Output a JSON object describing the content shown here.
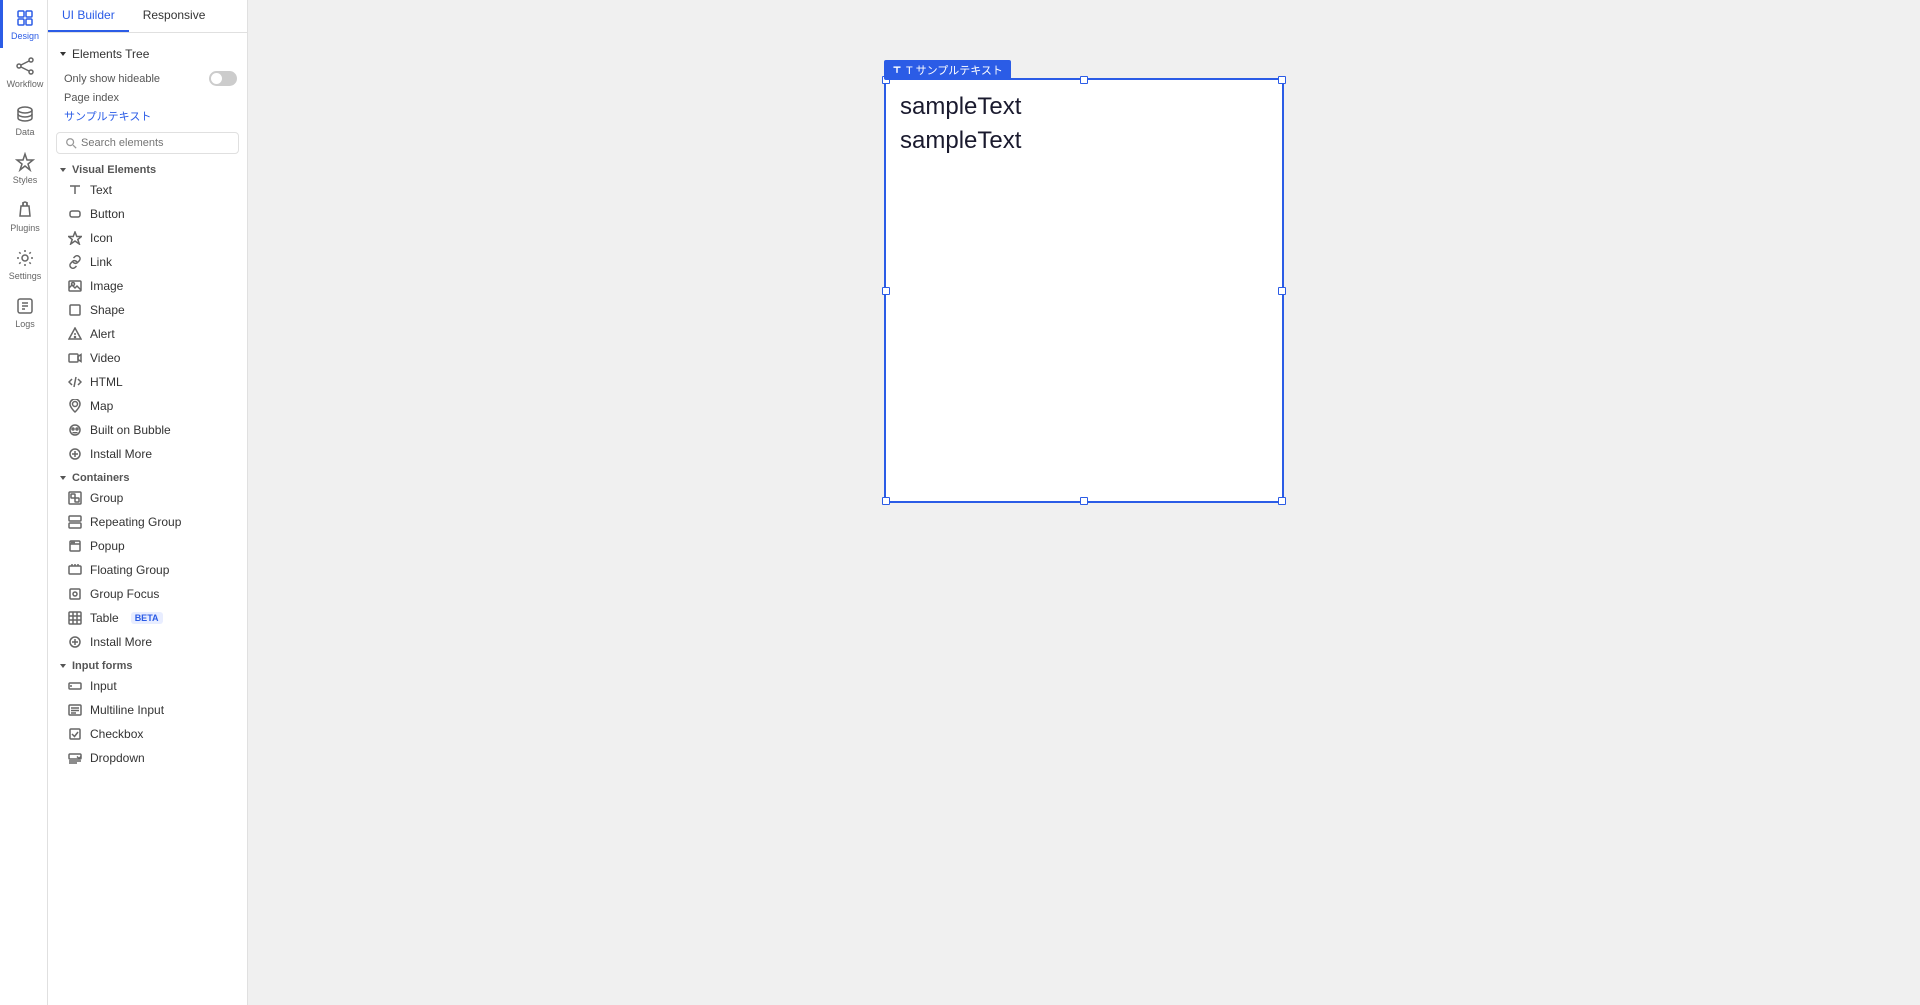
{
  "nav": {
    "items": [
      {
        "id": "design",
        "label": "Design",
        "active": true
      },
      {
        "id": "workflow",
        "label": "Workflow",
        "active": false
      },
      {
        "id": "data",
        "label": "Data",
        "active": false
      },
      {
        "id": "styles",
        "label": "Styles",
        "active": false
      },
      {
        "id": "plugins",
        "label": "Plugins",
        "active": false
      },
      {
        "id": "settings",
        "label": "Settings",
        "active": false
      },
      {
        "id": "logs",
        "label": "Logs",
        "active": false
      }
    ]
  },
  "tabs": {
    "ui_builder": "UI Builder",
    "responsive": "Responsive",
    "active": "UI Builder"
  },
  "elements_tree": {
    "label": "Elements Tree",
    "only_show_hideable": "Only show hideable",
    "page_index": "Page index",
    "page_name": "サンプルテキスト",
    "search_placeholder": "Search elements"
  },
  "visual_elements": {
    "section_label": "Visual Elements",
    "items": [
      {
        "id": "text",
        "label": "Text"
      },
      {
        "id": "button",
        "label": "Button"
      },
      {
        "id": "icon",
        "label": "Icon"
      },
      {
        "id": "link",
        "label": "Link"
      },
      {
        "id": "image",
        "label": "Image"
      },
      {
        "id": "shape",
        "label": "Shape"
      },
      {
        "id": "alert",
        "label": "Alert"
      },
      {
        "id": "video",
        "label": "Video"
      },
      {
        "id": "html",
        "label": "HTML"
      },
      {
        "id": "map",
        "label": "Map"
      },
      {
        "id": "built-on-bubble",
        "label": "Built on Bubble"
      },
      {
        "id": "install-more-visual",
        "label": "Install More"
      }
    ]
  },
  "containers": {
    "section_label": "Containers",
    "items": [
      {
        "id": "group",
        "label": "Group"
      },
      {
        "id": "repeating-group",
        "label": "Repeating Group"
      },
      {
        "id": "popup",
        "label": "Popup"
      },
      {
        "id": "floating-group",
        "label": "Floating Group"
      },
      {
        "id": "group-focus",
        "label": "Group Focus"
      },
      {
        "id": "table",
        "label": "Table",
        "badge": "BETA"
      },
      {
        "id": "install-more-containers",
        "label": "Install More"
      }
    ]
  },
  "input_forms": {
    "section_label": "Input forms",
    "items": [
      {
        "id": "input",
        "label": "Input"
      },
      {
        "id": "multiline-input",
        "label": "Multiline Input"
      },
      {
        "id": "checkbox",
        "label": "Checkbox"
      },
      {
        "id": "dropdown",
        "label": "Dropdown"
      }
    ]
  },
  "canvas": {
    "element_label": "T サンプルテキスト",
    "text_lines": [
      "sampleText",
      "sampleText"
    ]
  },
  "colors": {
    "accent": "#2b5ce6",
    "border_selected": "#2b5ce6",
    "orange_border": "#c8a84b"
  }
}
